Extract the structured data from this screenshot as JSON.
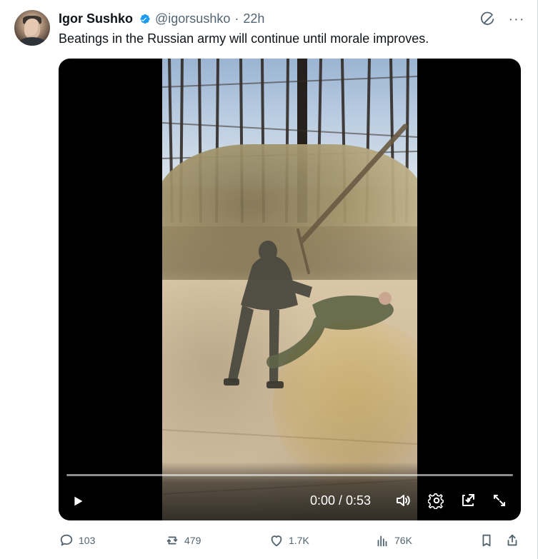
{
  "author": {
    "name": "Igor Sushko",
    "handle": "@igorsushko",
    "separator": "·",
    "time_ago": "22h",
    "verified": true
  },
  "tweet": {
    "text": "Beatings in the Russian army will continue until morale improves."
  },
  "video": {
    "time_label": "0:00 / 0:53",
    "progress": 0.0
  },
  "metrics": {
    "replies": "103",
    "reposts": "479",
    "likes": "1.7K",
    "views": "76K"
  },
  "colors": {
    "text_primary": "#0f1419",
    "text_secondary": "#536471",
    "verified_blue": "#1d9bf0",
    "divider": "#cfd9de"
  },
  "icons": {
    "top_right_1": "grok-icon",
    "top_right_2": "more-icon",
    "play": "play-icon",
    "volume": "volume-icon",
    "settings": "settings-icon",
    "pip": "pip-icon",
    "fullscreen": "fullscreen-icon",
    "reply": "reply-icon",
    "retweet": "retweet-icon",
    "like": "like-icon",
    "views": "views-icon",
    "bookmark": "bookmark-icon",
    "share": "share-icon"
  }
}
